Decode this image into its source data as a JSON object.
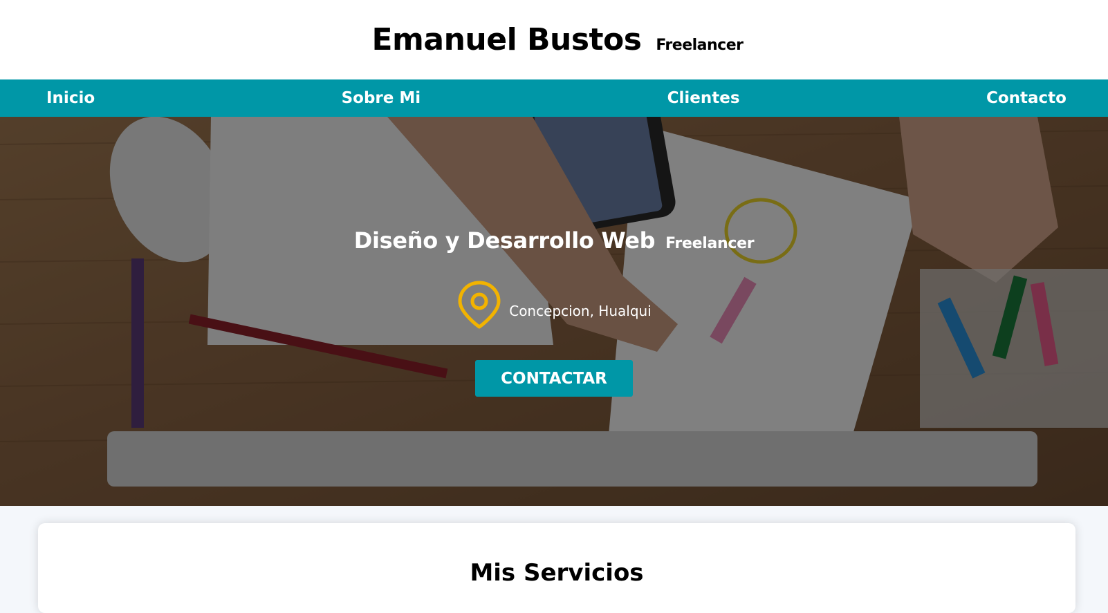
{
  "header": {
    "name": "Emanuel Bustos",
    "tagline": "Freelancer"
  },
  "nav": {
    "items": [
      {
        "label": "Inicio"
      },
      {
        "label": "Sobre Mi"
      },
      {
        "label": "Clientes"
      },
      {
        "label": "Contacto"
      }
    ]
  },
  "hero": {
    "title": "Diseño y Desarrollo Web",
    "title_sub": "Freelancer",
    "location_icon": "map-pin-icon",
    "location": "Concepcion, Hualqui",
    "cta_label": "CONTACTAR",
    "background_image": "desk-workspace-photo"
  },
  "services": {
    "title": "Mis Servicios"
  },
  "colors": {
    "accent": "#0097a7",
    "pin": "#f2b300",
    "page_bg": "#f4f7fb"
  }
}
